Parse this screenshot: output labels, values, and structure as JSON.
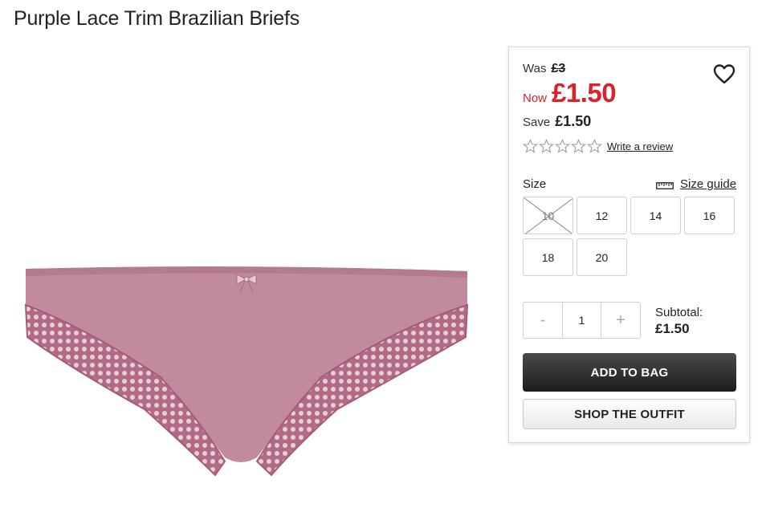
{
  "product": {
    "title": "Purple Lace Trim Brazilian Briefs",
    "image_alt": "product-photo-purple-briefs"
  },
  "pricing": {
    "was_label": "Was",
    "was_price": "£3",
    "now_label": "Now",
    "now_price": "£1.50",
    "save_label": "Save",
    "save_price": "£1.50",
    "sale_color": "#d8232a"
  },
  "wishlist": {
    "icon": "heart-outline-icon"
  },
  "reviews": {
    "rating": 0,
    "max": 5,
    "link_label": "Write a review"
  },
  "size": {
    "label": "Size",
    "guide_label": "Size guide",
    "options": [
      {
        "label": "10",
        "available": false
      },
      {
        "label": "12",
        "available": true
      },
      {
        "label": "14",
        "available": true
      },
      {
        "label": "16",
        "available": true
      },
      {
        "label": "18",
        "available": true
      },
      {
        "label": "20",
        "available": true
      }
    ]
  },
  "quantity": {
    "minus": "-",
    "value": "1",
    "plus": "+"
  },
  "subtotal": {
    "label": "Subtotal:",
    "value": "£1.50"
  },
  "actions": {
    "add_to_bag": "ADD TO BAG",
    "shop_outfit": "SHOP THE OUTFIT"
  }
}
